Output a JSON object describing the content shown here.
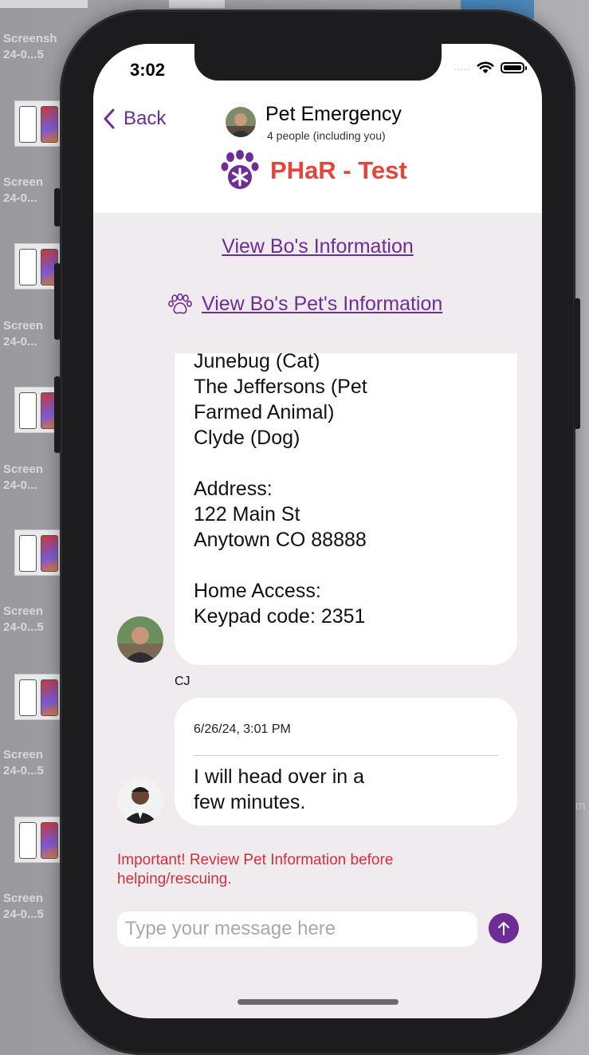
{
  "desktop": {
    "labels": [
      "Screensh",
      "24-0...5",
      "Screen",
      "24-0...",
      "Screen",
      "24-0...",
      "Screen",
      "24-0...",
      "Screen",
      "24-0...5",
      "Screen",
      "24-0...5",
      "Screen",
      "24-0...5",
      "Screen",
      "24-0...5"
    ],
    "edge_text": "m"
  },
  "status_bar": {
    "time": "3:02",
    "signal_dots": "....."
  },
  "header": {
    "back_label": "Back",
    "chat_title": "Pet Emergency",
    "chat_subtitle": "4 people (including you)",
    "brand_name": "PHaR - Test",
    "brand_color": "#e8433b",
    "accent_color": "#6d2d96"
  },
  "links": {
    "view_info": "View Bo's Information",
    "view_pet_info": "View Bo's Pet's Information"
  },
  "messages": [
    {
      "lines": [
        "Junebug (Cat)",
        "The Jeffersons (Pet",
        "Farmed Animal)",
        "Clyde (Dog)",
        "",
        "Address:",
        "122 Main St",
        "Anytown CO 88888",
        "",
        "Home Access:",
        "Keypad code: 2351"
      ],
      "sender": "CJ"
    },
    {
      "timestamp": "6/26/24, 3:01 PM",
      "lines": [
        "I will head over in a",
        "few minutes."
      ]
    }
  ],
  "composer": {
    "warning": "Important! Review Pet Information before helping/rescuing.",
    "placeholder": "Type your message here",
    "send_icon": "arrow-up-icon"
  }
}
